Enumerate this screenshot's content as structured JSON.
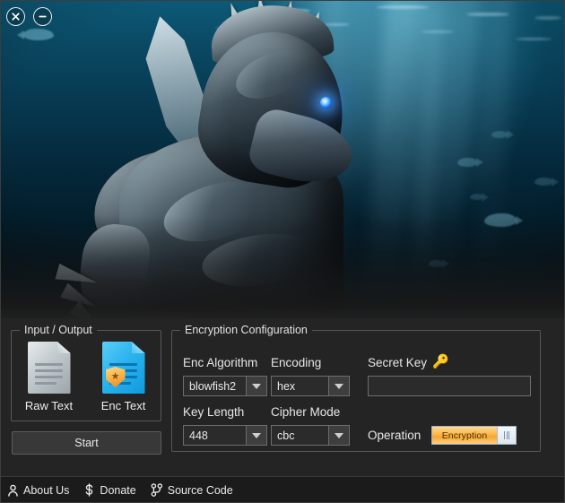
{
  "window": {
    "controls": [
      {
        "name": "close-button",
        "glyph": "×"
      },
      {
        "name": "minimize-button",
        "glyph": "−"
      }
    ]
  },
  "hero": {
    "alt": "Underwater scene with armored aquatic creature and fish",
    "accent_blue": "#0d5a78",
    "eye_glow": "#1d79ff"
  },
  "io_group": {
    "title": "Input / Output",
    "items": [
      {
        "label": "Raw Text",
        "icon": "document-grey-icon"
      },
      {
        "label": "Enc Text",
        "icon": "document-encrypted-icon"
      }
    ],
    "start_label": "Start"
  },
  "enc_group": {
    "title": "Encryption Configuration",
    "fields": {
      "enc_algorithm": {
        "label": "Enc Algorithm",
        "value": "blowfish2"
      },
      "encoding": {
        "label": "Encoding",
        "value": "hex"
      },
      "key_length": {
        "label": "Key Length",
        "value": "448"
      },
      "cipher_mode": {
        "label": "Cipher Mode",
        "value": "cbc"
      },
      "secret_key": {
        "label": "Secret Key",
        "value": "",
        "placeholder": "",
        "icon": "key-icon",
        "icon_glyph": "🔑"
      },
      "operation": {
        "label": "Operation",
        "value": "Encryption"
      }
    }
  },
  "statusbar": {
    "items": [
      {
        "label": "About Us",
        "icon": "person-icon"
      },
      {
        "label": "Donate",
        "icon": "dollar-icon"
      },
      {
        "label": "Source Code",
        "icon": "git-branch-icon"
      }
    ]
  },
  "colors": {
    "panel_bg": "#242424",
    "statusbar_bg": "#1b1b1b",
    "group_border": "#575757",
    "accent_orange": "#f6a52c",
    "text": "#e9e9e9"
  }
}
